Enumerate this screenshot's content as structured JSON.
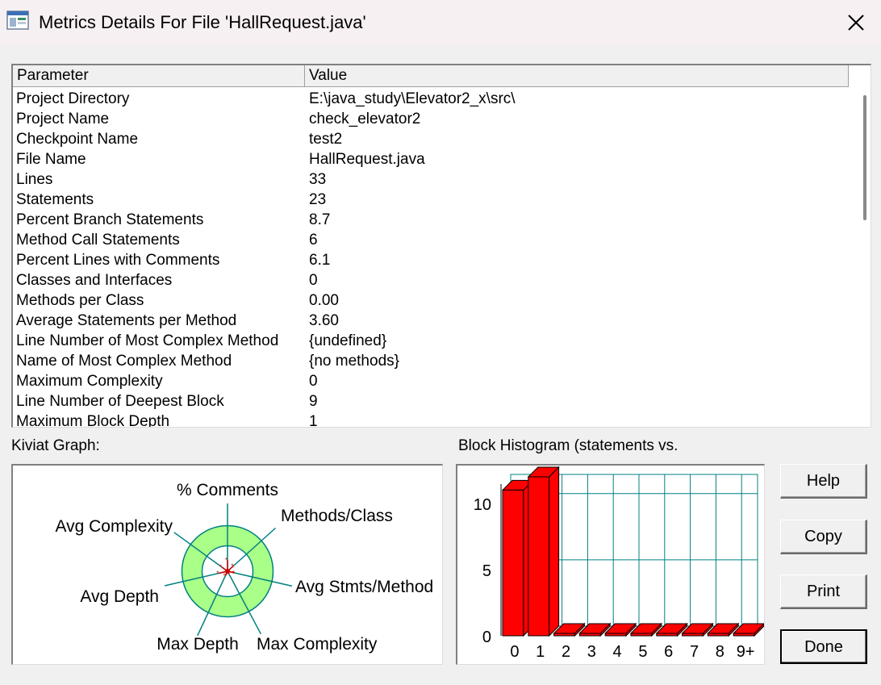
{
  "window": {
    "title": "Metrics Details For File 'HallRequest.java'",
    "icon": "app-window-icon",
    "close_icon": "close-icon"
  },
  "table": {
    "columns": [
      "Parameter",
      "Value"
    ],
    "rows": [
      [
        "Project Directory",
        "E:\\java_study\\Elevator2_x\\src\\"
      ],
      [
        "Project Name",
        "check_elevator2"
      ],
      [
        "Checkpoint Name",
        "test2"
      ],
      [
        "File Name",
        "HallRequest.java"
      ],
      [
        "Lines",
        "33"
      ],
      [
        "Statements",
        "23"
      ],
      [
        "Percent Branch Statements",
        "8.7"
      ],
      [
        "Method Call Statements",
        "6"
      ],
      [
        "Percent Lines with Comments",
        "6.1"
      ],
      [
        "Classes and Interfaces",
        "0"
      ],
      [
        "Methods per Class",
        "0.00"
      ],
      [
        "Average Statements per Method",
        "3.60"
      ],
      [
        "Line Number of Most Complex Method",
        "{undefined}"
      ],
      [
        "Name of Most Complex Method",
        "{no methods}"
      ],
      [
        "Maximum Complexity",
        "0"
      ],
      [
        "Line Number of Deepest Block",
        "9"
      ],
      [
        "Maximum Block Depth",
        "1"
      ]
    ]
  },
  "kiviat": {
    "label": "Kiviat Graph:",
    "axes": [
      "% Comments",
      "Methods/Class",
      "Avg Stmts/Method",
      "Max Complexity",
      "Max Depth",
      "Avg Depth",
      "Avg Complexity"
    ],
    "colors": {
      "ring": "#aaff88",
      "axis": "#008080",
      "marker": "#cc0000"
    }
  },
  "histogram": {
    "label": "Block Histogram (statements vs.",
    "colors": {
      "bar": "#ff0000",
      "grid": "#008080"
    }
  },
  "chart_data": {
    "type": "bar",
    "title": "Block Histogram (statements vs.",
    "categories": [
      "0",
      "1",
      "2",
      "3",
      "4",
      "5",
      "6",
      "7",
      "8",
      "9+"
    ],
    "values": [
      11,
      12,
      0,
      0,
      0,
      0,
      0,
      0,
      0,
      0
    ],
    "ylim": [
      0,
      12
    ],
    "yticks": [
      "0",
      "5",
      "10"
    ]
  },
  "buttons": {
    "help": "Help",
    "copy": "Copy",
    "print": "Print",
    "done": "Done"
  }
}
